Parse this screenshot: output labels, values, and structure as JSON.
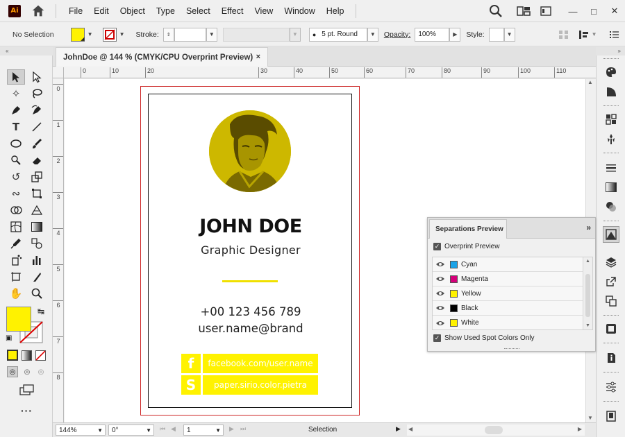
{
  "menu": {
    "logo": "Ai",
    "items": [
      "File",
      "Edit",
      "Object",
      "Type",
      "Select",
      "Effect",
      "View",
      "Window",
      "Help"
    ]
  },
  "control": {
    "selection": "No Selection",
    "stroke_label": "Stroke:",
    "brush": "5 pt. Round",
    "opacity_label": "Opacity:",
    "opacity_value": "100%",
    "style_label": "Style:"
  },
  "document": {
    "tab_title": "JohnDoe  @ 144 % (CMYK/CPU Overprint Preview)",
    "close_glyph": "×"
  },
  "ruler": {
    "h_labels": [
      "0",
      "10",
      "20",
      "30",
      "40",
      "50",
      "60",
      "70",
      "80",
      "90",
      "100",
      "110"
    ],
    "v_labels": [
      "0",
      "1",
      "2",
      "3",
      "4",
      "5",
      "6",
      "7",
      "8"
    ]
  },
  "card": {
    "name": "JOHN DOE",
    "title": "Graphic Designer",
    "phone": "+00 123 456 789",
    "email": "user.name@brand",
    "social": [
      {
        "icon_letter": "f",
        "text": "facebook.com/user.name"
      },
      {
        "icon_letter": "S",
        "text": "paper.sirio.color.pietra"
      }
    ],
    "accent_color": "#fff200",
    "photo_tint": "#c8b300"
  },
  "separations": {
    "tab_title": "Separations Preview",
    "menu_glyph": "»",
    "overprint_label": "Overprint Preview",
    "inks": [
      {
        "name": "Cyan",
        "color": "#1aa3e8"
      },
      {
        "name": "Magenta",
        "color": "#d4007a"
      },
      {
        "name": "Yellow",
        "color": "#fff200"
      },
      {
        "name": "Black",
        "color": "#000000"
      },
      {
        "name": "White",
        "color": "#fff200"
      }
    ],
    "spot_label": "Show Used Spot Colors Only"
  },
  "status": {
    "zoom": "144%",
    "rotation": "0°",
    "artboard": "1",
    "tool": "Selection"
  }
}
